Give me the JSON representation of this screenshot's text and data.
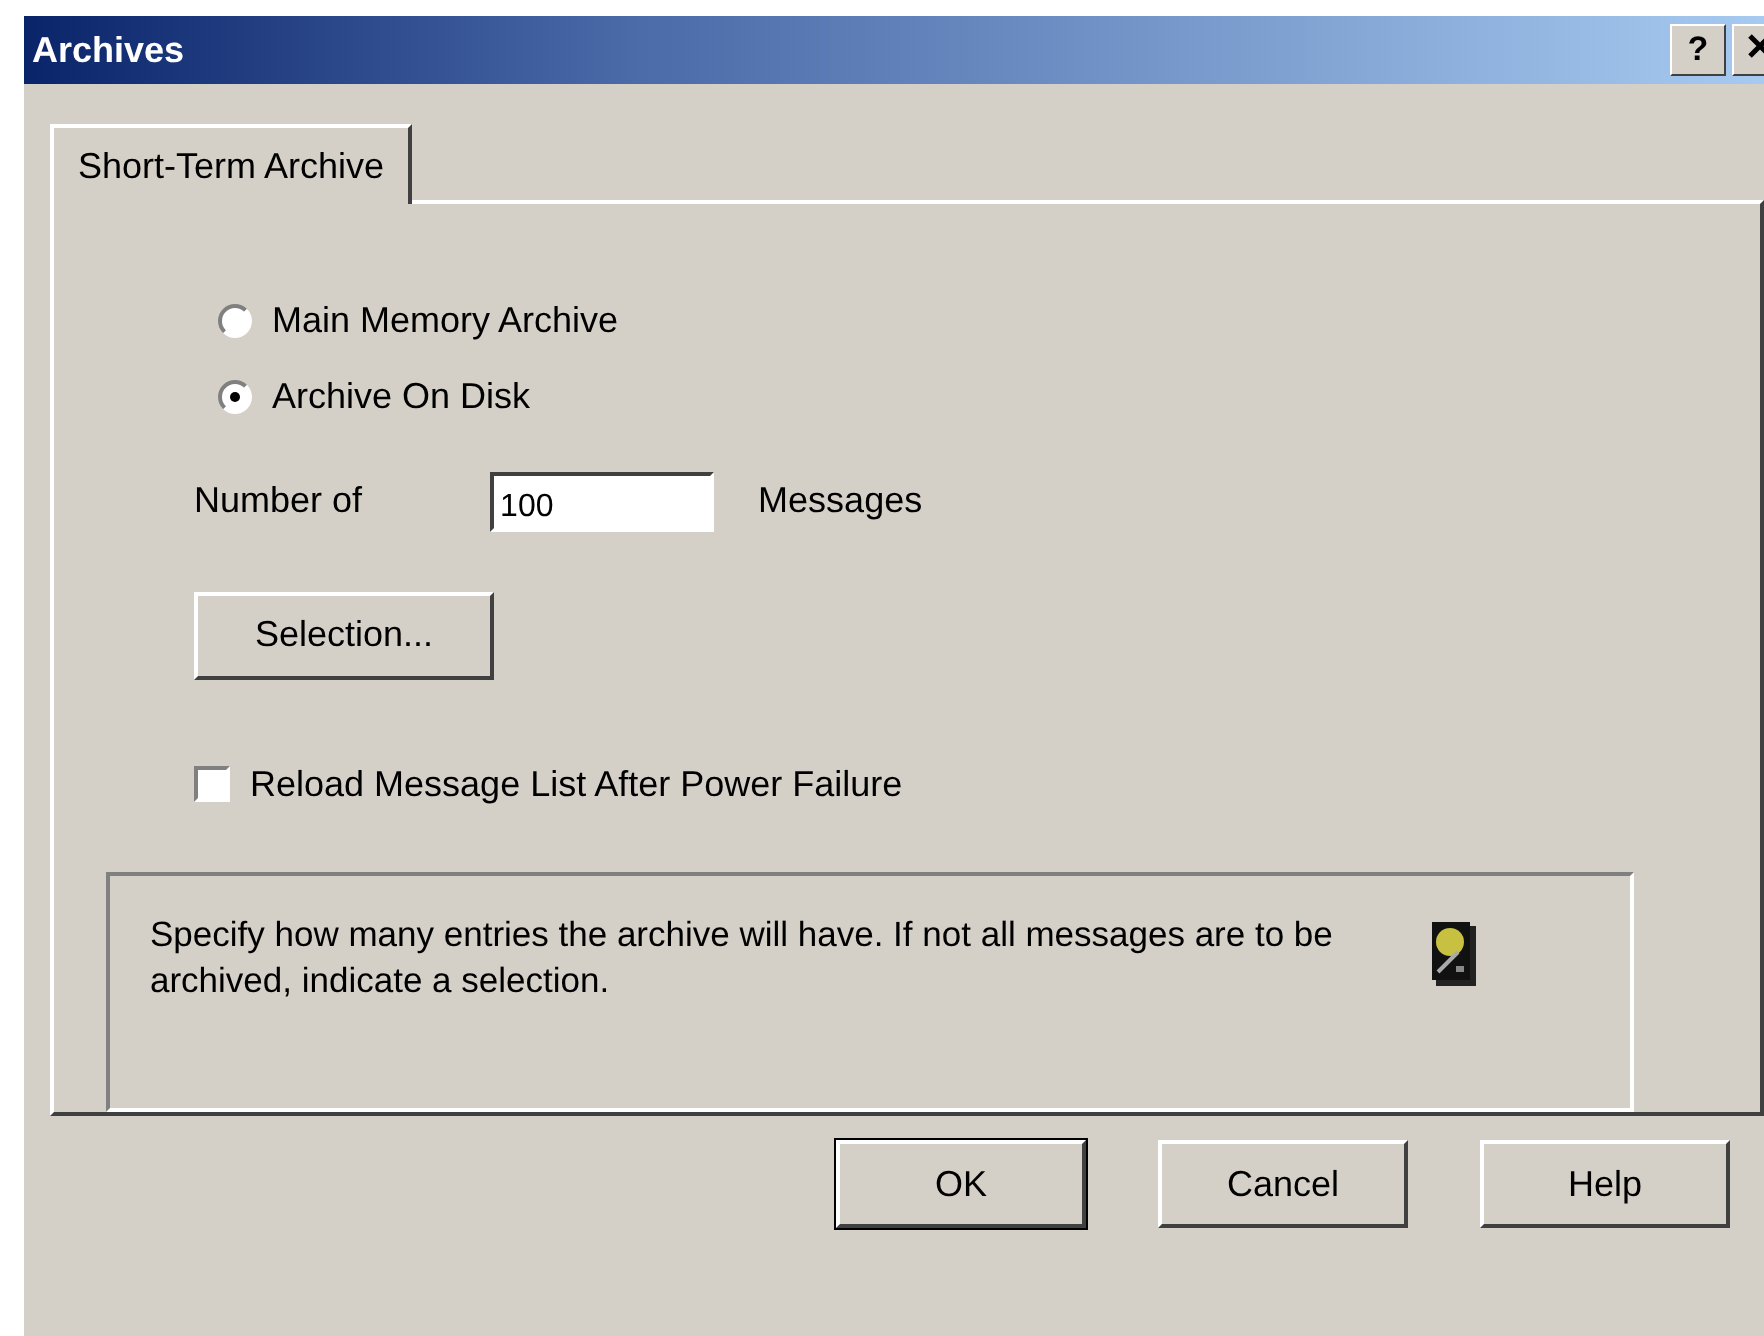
{
  "window": {
    "title": "Archives",
    "help_button": "?",
    "close_button": true
  },
  "tabs": [
    {
      "label": "Short-Term Archive",
      "selected": true
    }
  ],
  "archive_options": [
    {
      "label": "Main Memory Archive",
      "selected": false
    },
    {
      "label": "Archive On Disk",
      "selected": true
    }
  ],
  "count": {
    "label": "Number of",
    "value": "100",
    "unit": "Messages"
  },
  "selection_button": "Selection...",
  "reload_checkbox": {
    "label": "Reload Message List After Power Failure",
    "checked": false
  },
  "info": {
    "text": "Specify how many entries the archive will have. If not all messages are to be archived, indicate a selection."
  },
  "buttons": [
    {
      "label": "OK",
      "default": true
    },
    {
      "label": "Cancel",
      "default": false
    },
    {
      "label": "Help",
      "default": false
    }
  ]
}
